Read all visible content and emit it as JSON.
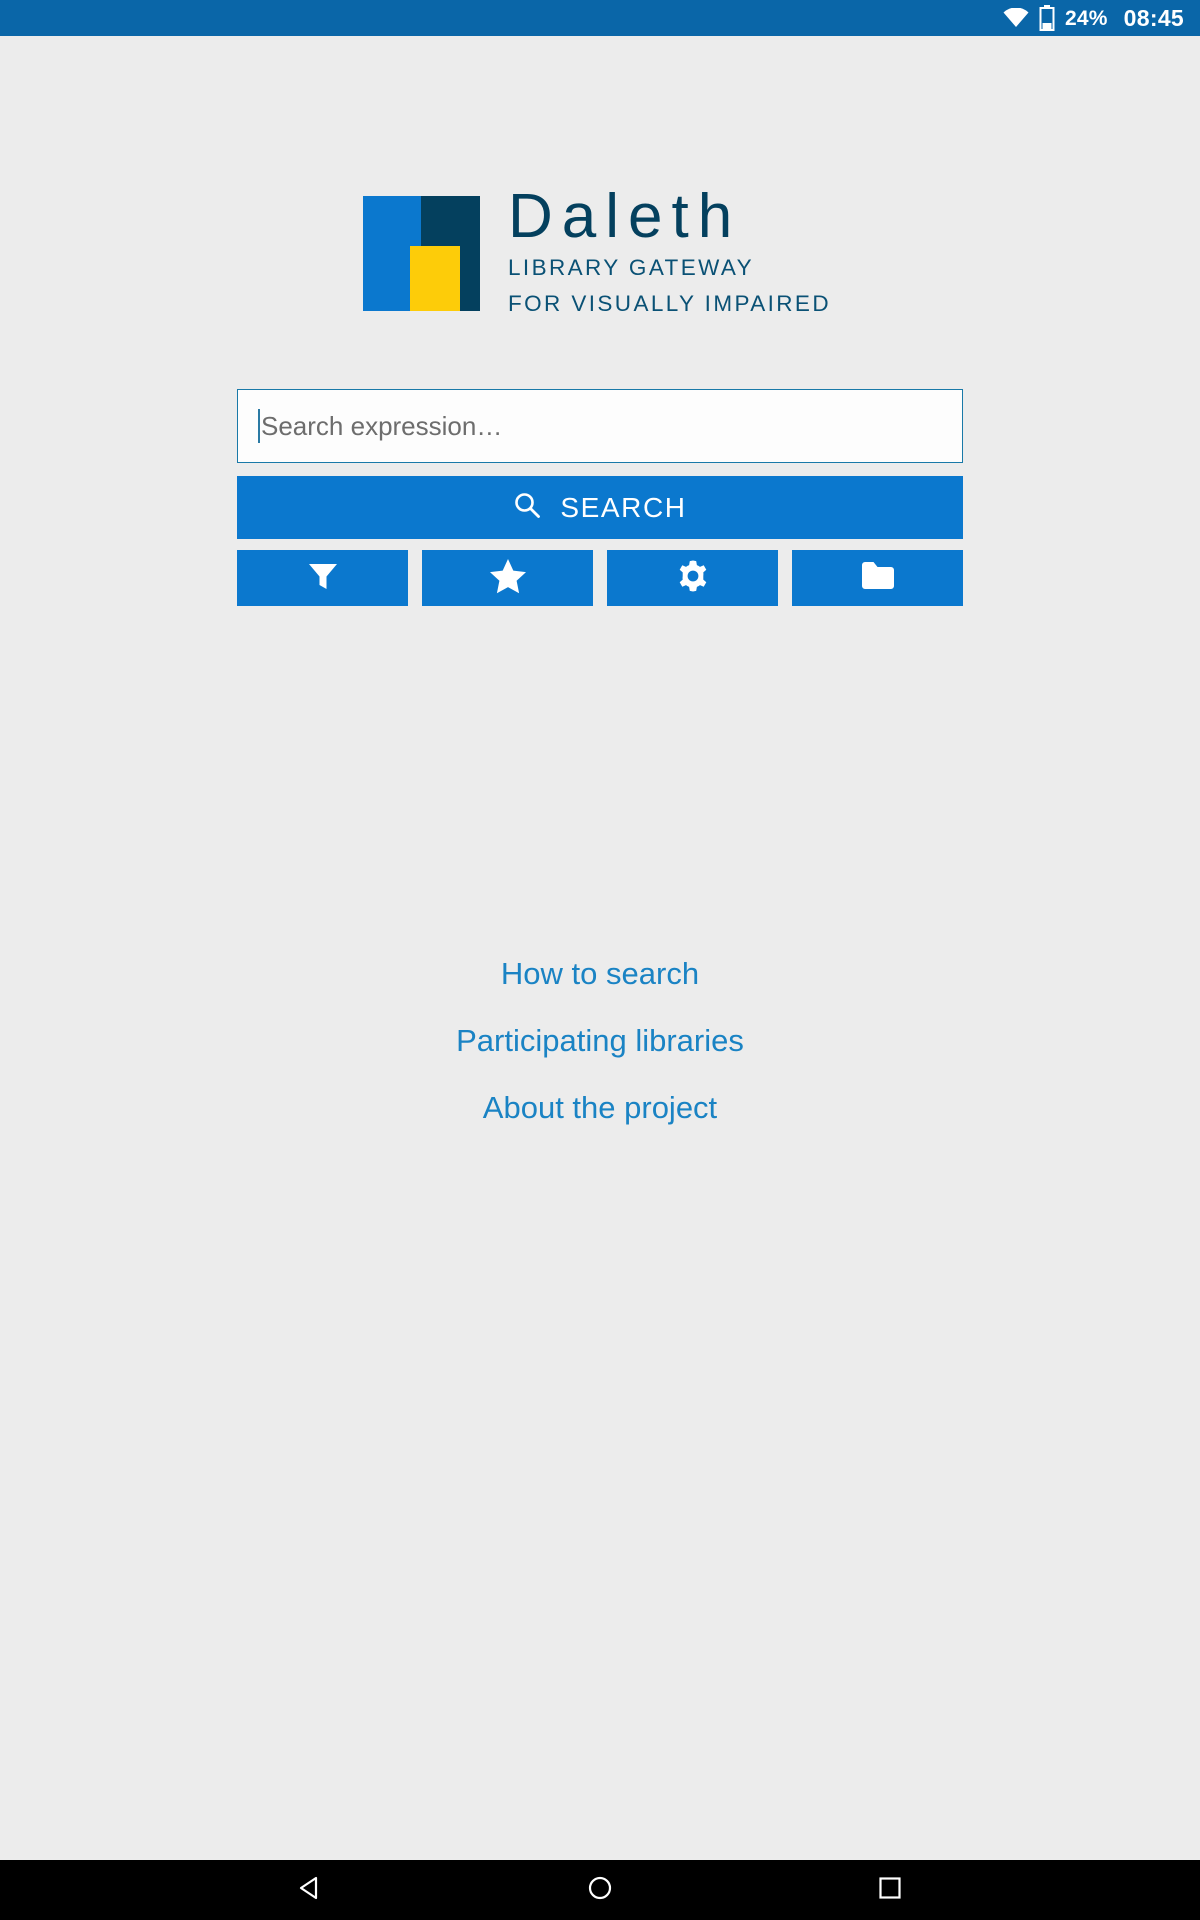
{
  "status_bar": {
    "wifi_icon": "wifi-icon",
    "battery_icon": "battery-icon",
    "battery_percent": "24%",
    "clock": "08:45",
    "background_color": "#0a66a8"
  },
  "logo": {
    "mark_icon": "daleth-logo-mark",
    "title": "Daleth",
    "subtitle_line1": "LIBRARY GATEWAY",
    "subtitle_line2": "FOR VISUALLY IMPAIRED",
    "colors": {
      "blue": "#0b78ce",
      "navy": "#04405e",
      "yellow": "#fdcc09"
    }
  },
  "search": {
    "placeholder": "Search expression…",
    "value": "",
    "button_label": "SEARCH",
    "button_icon": "search-icon",
    "accent_color": "#0b78ce"
  },
  "toolbar": {
    "buttons": [
      {
        "name": "filter-button",
        "icon": "filter-icon"
      },
      {
        "name": "favorites-button",
        "icon": "star-icon"
      },
      {
        "name": "settings-button",
        "icon": "gear-icon"
      },
      {
        "name": "files-button",
        "icon": "folder-icon"
      }
    ]
  },
  "links": [
    {
      "label": "How to search"
    },
    {
      "label": "Participating libraries"
    },
    {
      "label": "About the project"
    }
  ],
  "nav_bar": {
    "back_icon": "back-triangle-icon",
    "home_icon": "home-circle-icon",
    "recents_icon": "recents-square-icon"
  }
}
